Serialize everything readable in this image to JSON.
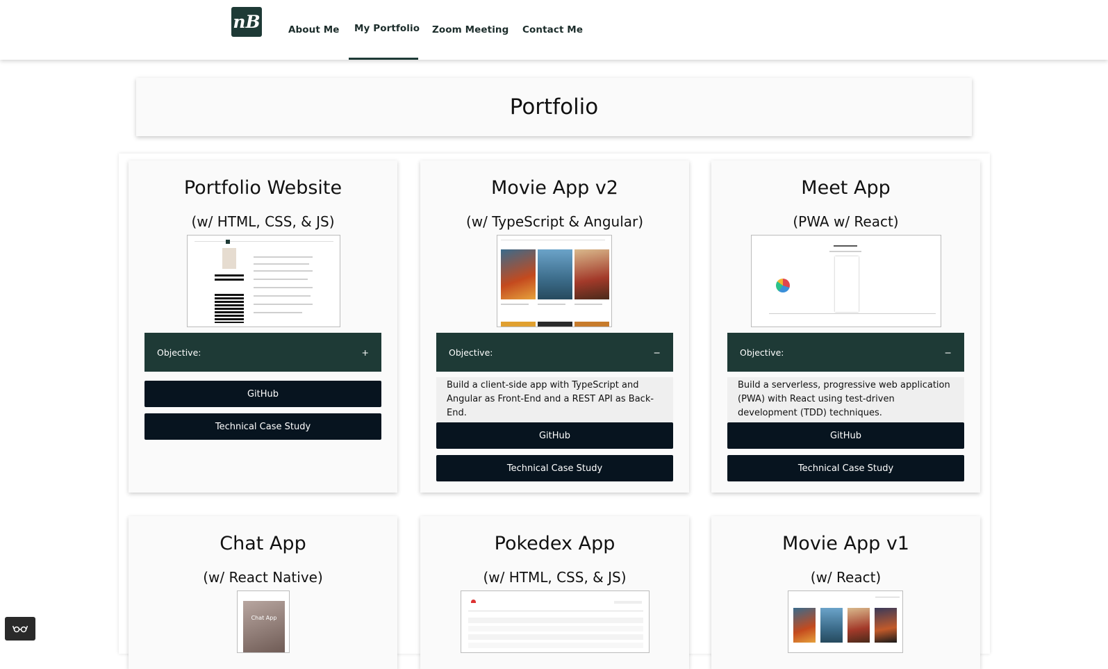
{
  "brand": {
    "logo_text": "nB"
  },
  "nav": {
    "about": "About Me",
    "portfolio": "My Portfolio",
    "zoom": "Zoom Meeting",
    "contact": "Contact Me"
  },
  "page": {
    "title": "Portfolio"
  },
  "colors": {
    "accent": "#1e3a36",
    "button": "#07141f",
    "card_bg": "#fafafa"
  },
  "cards": [
    {
      "title": "Portfolio Website",
      "subtitle": "(w/ HTML, CSS, & JS)",
      "objective_label": "Objective:",
      "toggle": "+",
      "description": "",
      "github": "GitHub",
      "case_study": "Technical Case Study"
    },
    {
      "title": "Movie App v2",
      "subtitle": "(w/ TypeScript & Angular)",
      "objective_label": "Objective:",
      "toggle": "−",
      "description": "Build a client-side app with TypeScript and Angular as Front-End and a REST API as Back-End.",
      "github": "GitHub",
      "case_study": "Technical Case Study"
    },
    {
      "title": "Meet App",
      "subtitle": "(PWA w/ React)",
      "objective_label": "Objective:",
      "toggle": "−",
      "description": "Build a serverless, progressive web application (PWA) with React using test-driven development (TDD) techniques.",
      "github": "GitHub",
      "case_study": "Technical Case Study"
    },
    {
      "title": "Chat App",
      "subtitle": "(w/ React Native)",
      "thumb_text": "Chat App"
    },
    {
      "title": "Pokedex App",
      "subtitle": "(w/ HTML, CSS, & JS)"
    },
    {
      "title": "Movie App v1",
      "subtitle": "(w/ React)"
    }
  ],
  "icons": {
    "floating": "glasses-icon",
    "toggle_open": "plus-icon",
    "toggle_close": "minus-icon"
  }
}
